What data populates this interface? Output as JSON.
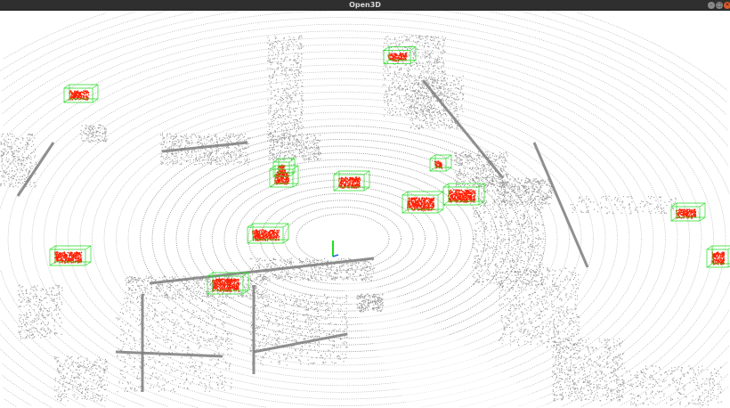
{
  "window": {
    "title": "Open3D",
    "controls": {
      "minimize": "–",
      "maximize": "□",
      "close": "✕"
    }
  },
  "scene": {
    "point_color": "#7d7d7d",
    "object_point_color": "#ff1e00",
    "box_color": "#22dd22",
    "axis_color": "#22dd22",
    "background": "#ffffff"
  }
}
